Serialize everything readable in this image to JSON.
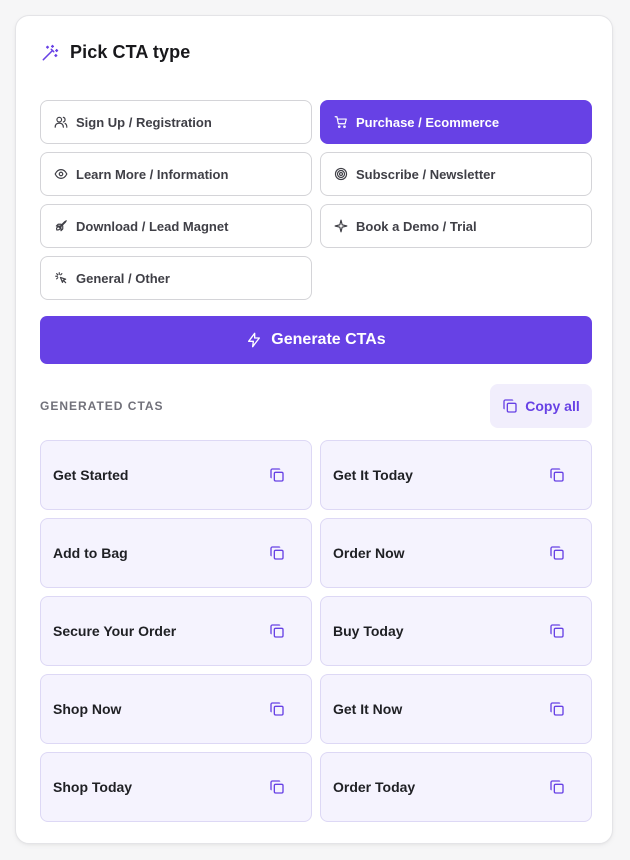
{
  "header": {
    "title": "Pick CTA type",
    "icon": "magic-wand-icon"
  },
  "cta_types": [
    {
      "label": "Sign Up / Registration",
      "icon": "users-icon",
      "selected": false
    },
    {
      "label": "Purchase / Ecommerce",
      "icon": "cart-icon",
      "selected": true
    },
    {
      "label": "Learn More / Information",
      "icon": "eye-icon",
      "selected": false
    },
    {
      "label": "Subscribe / Newsletter",
      "icon": "target-icon",
      "selected": false
    },
    {
      "label": "Download / Lead Magnet",
      "icon": "rocket-icon",
      "selected": false
    },
    {
      "label": "Book a Demo / Trial",
      "icon": "sparkle-icon",
      "selected": false
    },
    {
      "label": "General / Other",
      "icon": "pointer-click-icon",
      "selected": false
    }
  ],
  "generate_button": {
    "label": "Generate CTAs",
    "icon": "lightning-icon"
  },
  "results_section": {
    "label": "GENERATED CTAS",
    "copy_all_label": "Copy all"
  },
  "generated": [
    "Get Started",
    "Get It Today",
    "Add to Bag",
    "Order Now",
    "Secure Your Order",
    "Buy Today",
    "Shop Now",
    "Get It Now",
    "Shop Today",
    "Order Today"
  ],
  "colors": {
    "accent": "#6741e5",
    "result_bg": "#f5f3fe",
    "copy_all_bg": "#f1eefc"
  }
}
